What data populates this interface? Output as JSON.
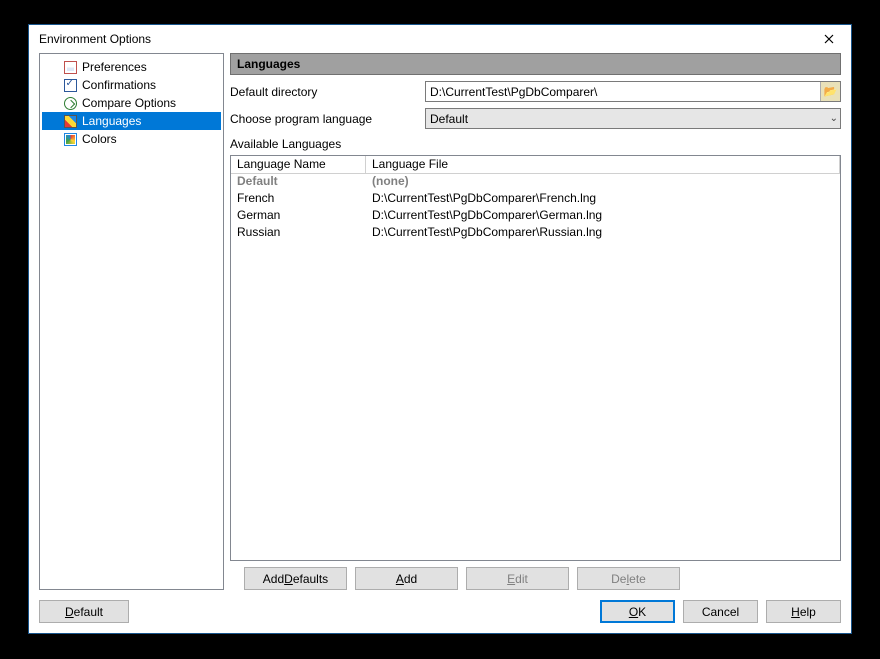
{
  "window": {
    "title": "Environment Options"
  },
  "tree": {
    "items": [
      {
        "label": "Preferences"
      },
      {
        "label": "Confirmations"
      },
      {
        "label": "Compare Options"
      },
      {
        "label": "Languages"
      },
      {
        "label": "Colors"
      }
    ]
  },
  "panel": {
    "header": "Languages",
    "default_dir_label": "Default directory",
    "default_dir_value": "D:\\CurrentTest\\PgDbComparer\\",
    "choose_lang_label": "Choose program language",
    "choose_lang_value": "Default",
    "available_label": "Available Languages",
    "columns": {
      "name": "Language Name",
      "file": "Language File"
    },
    "rows": [
      {
        "name": "Default",
        "file": "(none)",
        "is_default": true
      },
      {
        "name": "French",
        "file": "D:\\CurrentTest\\PgDbComparer\\French.lng"
      },
      {
        "name": "German",
        "file": "D:\\CurrentTest\\PgDbComparer\\German.lng"
      },
      {
        "name": "Russian",
        "file": "D:\\CurrentTest\\PgDbComparer\\Russian.lng"
      }
    ]
  },
  "buttons": {
    "add_defaults": {
      "pre": "Add ",
      "ul": "D",
      "post": "efaults"
    },
    "add": {
      "pre": "",
      "ul": "A",
      "post": "dd"
    },
    "edit": {
      "pre": "",
      "ul": "E",
      "post": "dit"
    },
    "delete": {
      "pre": "De",
      "ul": "l",
      "post": "ete"
    },
    "default": {
      "pre": "",
      "ul": "D",
      "post": "efault"
    },
    "ok": {
      "pre": "",
      "ul": "O",
      "post": "K"
    },
    "cancel": {
      "label": "Cancel"
    },
    "help": {
      "pre": "",
      "ul": "H",
      "post": "elp"
    }
  }
}
